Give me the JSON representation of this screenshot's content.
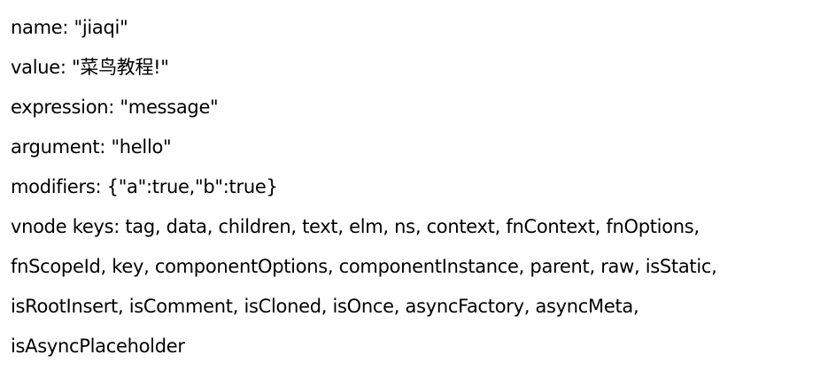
{
  "binding": {
    "name": "name: \"jiaqi\"",
    "value": "value: \"菜鸟教程!\"",
    "expression": "expression: \"message\"",
    "argument": "argument: \"hello\"",
    "modifiers": "modifiers: {\"a\":true,\"b\":true}",
    "vnode_keys_line1": "vnode keys: tag, data, children, text, elm, ns, context, fnContext, fnOptions,",
    "vnode_keys_line2": "fnScopeId, key, componentOptions, componentInstance, parent, raw, isStatic,",
    "vnode_keys_line3": "isRootInsert, isComment, isCloned, isOnce, asyncFactory, asyncMeta,",
    "vnode_keys_line4": "isAsyncPlaceholder"
  }
}
